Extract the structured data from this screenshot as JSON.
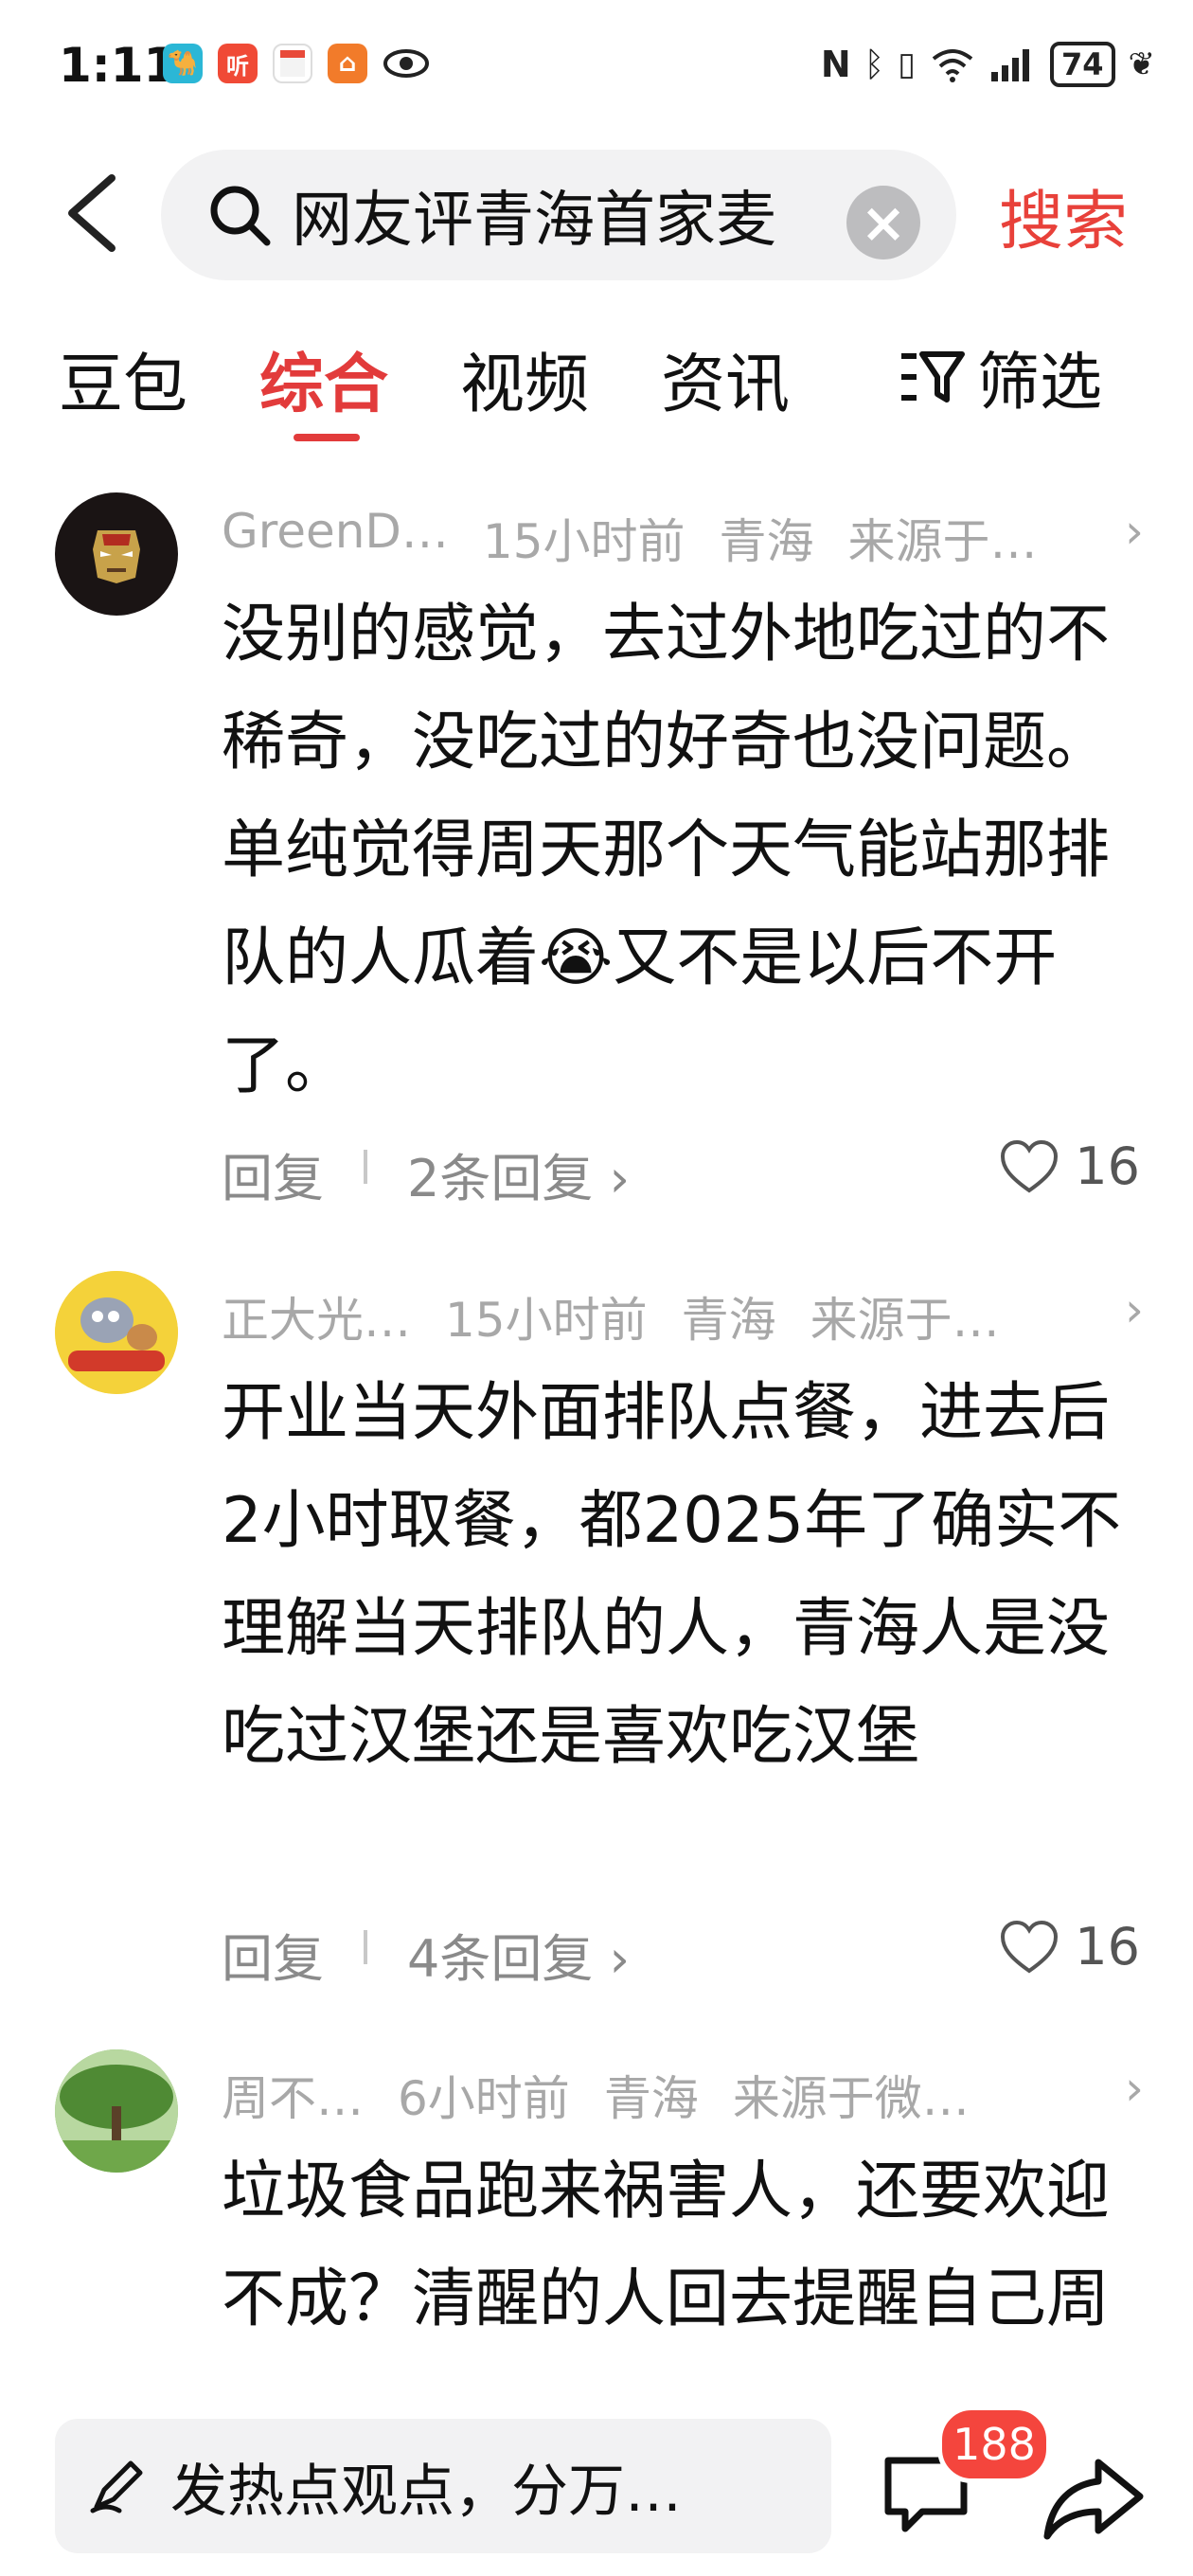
{
  "status": {
    "time": "1:11",
    "battery": "74",
    "app_icons": [
      "camel-app-icon",
      "listen-app-icon",
      "calendar-app-icon",
      "home-app-icon",
      "eye-icon"
    ],
    "system_icons": [
      "nfc-icon",
      "bluetooth-icon",
      "vibrate-icon",
      "wifi-icon",
      "signal-icon",
      "battery-icon",
      "leaf-icon"
    ]
  },
  "search": {
    "query": "网友评青海首家麦",
    "button": "搜索"
  },
  "tabs": {
    "items": [
      "豆包",
      "综合",
      "视频",
      "资讯"
    ],
    "active": "综合",
    "filter": "筛选"
  },
  "comments": [
    {
      "user": "GreenD…",
      "time": "15小时前",
      "region": "青海",
      "source": "来源于…",
      "text": "没别的感觉，去过外地吃过的不稀奇，没吃过的好奇也没问题。单纯觉得周天那个天气能站那排队的人瓜着😭又不是以后不开了。",
      "reply_label": "回复",
      "replies": "2条回复",
      "likes": "16"
    },
    {
      "user": "正大光…",
      "time": "15小时前",
      "region": "青海",
      "source": "来源于…",
      "text": "开业当天外面排队点餐，进去后2小时取餐，都2025年了确实不理解当天排队的人，青海人是没吃过汉堡还是喜欢吃汉堡",
      "reply_label": "回复",
      "replies": "4条回复",
      "likes": "16"
    },
    {
      "user": "周不…",
      "time": "6小时前",
      "region": "青海",
      "source": "来源于微…",
      "text": "垃圾食品跑来祸害人，还要欢迎不成？清醒的人回去提醒自己周围的亲友不去消费就行"
    }
  ],
  "bottom": {
    "placeholder": "发热点观点，分万…",
    "comment_count": "188"
  },
  "colors": {
    "accent": "#e23b3b",
    "badge": "#f4453d",
    "meta": "#a8a8a8"
  }
}
